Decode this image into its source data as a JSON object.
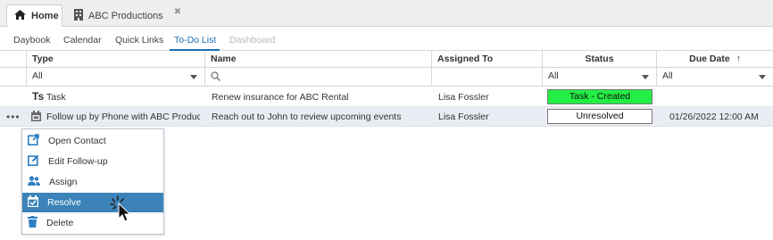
{
  "window_tabs": [
    {
      "label": "Home",
      "icon": "home-icon",
      "active": true
    },
    {
      "label": "ABC Productions",
      "icon": "building-icon",
      "close": "✖"
    }
  ],
  "subnav": {
    "items": [
      "Daybook",
      "Calendar",
      "Quick Links",
      "To-Do List",
      "Dashboard"
    ],
    "active": "To-Do List",
    "disabled": "Dashboard"
  },
  "grid": {
    "headers": {
      "type": "Type",
      "name": "Name",
      "assigned": "Assigned To",
      "status": "Status",
      "due": "Due Date"
    },
    "sort_indicator": "↑",
    "filters": {
      "type": "All",
      "status": "All",
      "due": "All"
    },
    "rows": [
      {
        "type_icon": "task-icon",
        "type_prefix": "Ts",
        "type": "Task",
        "name": "Renew insurance for ABC Rental",
        "assigned": "Lisa Fossler",
        "status": "Task - Created",
        "status_color": "#22ee44",
        "due": ""
      },
      {
        "type_icon": "calendar-phone-icon",
        "type": "Follow up by Phone with ABC Producti...",
        "name": "Reach out to John to review upcoming events",
        "assigned": "Lisa Fossler",
        "status": "Unresolved",
        "status_color": "#ffffff",
        "due": "01/26/2022 12:00 AM",
        "actions": "•••"
      }
    ]
  },
  "context_menu": {
    "items": [
      {
        "label": "Open Contact",
        "icon": "open-external-icon"
      },
      {
        "label": "Edit Follow-up",
        "icon": "edit-icon"
      },
      {
        "label": "Assign",
        "icon": "users-icon"
      },
      {
        "label": "Resolve",
        "icon": "calendar-check-icon",
        "highlighted": true
      },
      {
        "label": "Delete",
        "icon": "trash-icon"
      }
    ]
  },
  "colors": {
    "accent": "#1a6fb4",
    "menu_highlight": "#3b83b8",
    "icon_blue": "#2f7fc1"
  }
}
